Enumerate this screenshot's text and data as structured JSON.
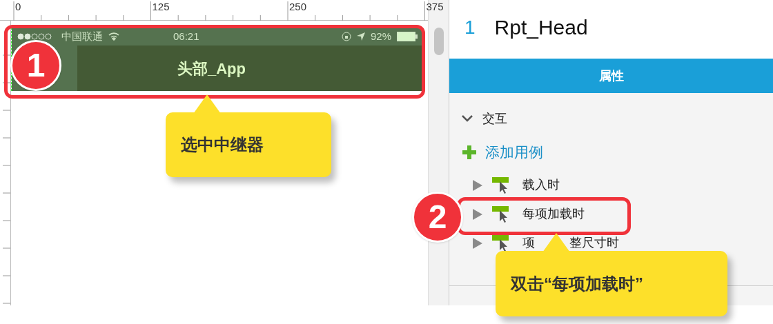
{
  "canvas": {
    "ruler_labels": [
      "0",
      "125",
      "250",
      "375"
    ],
    "status_bar": {
      "carrier": "中国联通",
      "time": "06:21",
      "battery": "92%"
    },
    "nav_title": "头部_App"
  },
  "panel": {
    "index": "1",
    "title": "Rpt_Head",
    "tabs": [
      {
        "label": "属性",
        "selected": true
      }
    ],
    "section": {
      "label": "交互",
      "expanded": true
    },
    "add_case": "添加用例",
    "events": [
      {
        "label": "载入时"
      },
      {
        "label": "每项加载时"
      },
      {
        "label": "项",
        "label_after_gap": "整尺寸时"
      }
    ]
  },
  "annotations": [
    {
      "number": "1",
      "text": "选中中继器"
    },
    {
      "number": "2",
      "text": "双击“每项加载时”"
    }
  ]
}
